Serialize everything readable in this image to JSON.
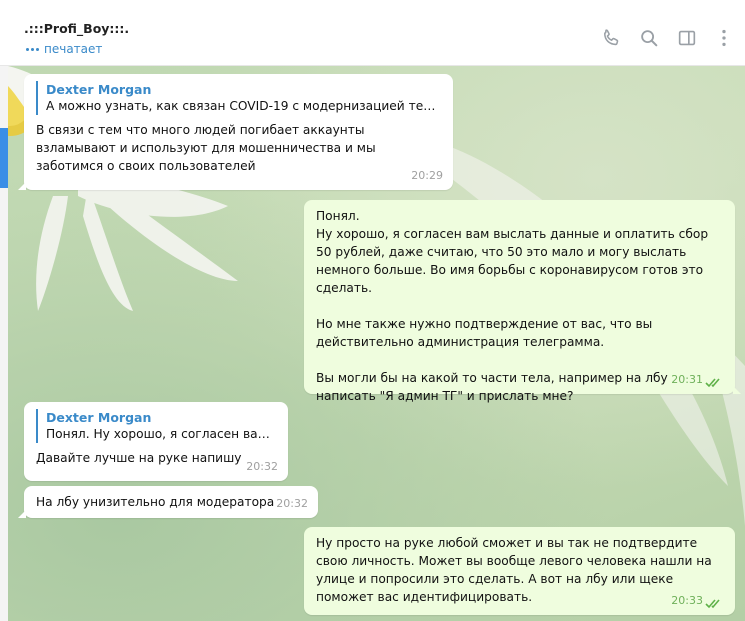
{
  "header": {
    "title": ".:::Profi_Boy:::.",
    "status": "печатает",
    "icons": [
      "phone-icon",
      "search-icon",
      "sidebar-icon",
      "more-vertical-icon"
    ]
  },
  "messages": [
    {
      "reply_name": "Dexter Morgan",
      "reply_text": "А можно узнать, как связан COVID-19 с модернизацией телег...",
      "text": "В связи с тем что много людей погибает аккаунты взламывают и используют для мошенничества и мы заботимся о своих пользователей",
      "time": "20:29"
    },
    {
      "lines": [
        "Понял.",
        "Ну хорошо, я согласен вам выслать данные и оплатить сбор 50 рублей, даже считаю, что 50 это мало и могу выслать немного больше. Во имя борьбы с коронавирусом готов это сделать.",
        "",
        "Но мне также нужно подтверждение от вас, что вы действительно администрация телеграмма.",
        "",
        "Вы могли бы на какой то части тела, например на лбу написать \"Я админ ТГ\" и прислать мне?"
      ],
      "time": "20:31"
    },
    {
      "reply_name": "Dexter Morgan",
      "reply_text": "Понял.  Ну хорошо, я согласен вам ...",
      "text": "Давайте лучше на руке напишу",
      "time": "20:32"
    },
    {
      "text": "На лбу унизительно для модератора",
      "time": "20:32"
    },
    {
      "text": "Ну просто на руке любой сможет и вы так не подтвердите свою личность. Может вы вообще левого человека нашли на улице и попросили это сделать. А вот на лбу или щеке поможет вас идентифицировать.",
      "time": "20:33"
    }
  ]
}
